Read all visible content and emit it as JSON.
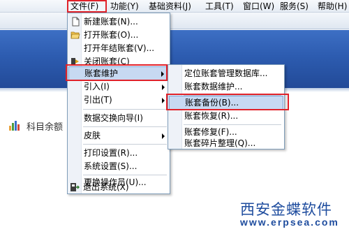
{
  "menubar": {
    "items": [
      {
        "label": "文件(F)",
        "key": "file"
      },
      {
        "label": "功能(Y)",
        "key": "func"
      },
      {
        "label": "基础资料(J)",
        "key": "base"
      },
      {
        "label": "工具(T)",
        "key": "tools"
      },
      {
        "label": "窗口(W)",
        "key": "window"
      },
      {
        "label": "服务(S)",
        "key": "service"
      },
      {
        "label": "帮助(H)",
        "key": "help"
      }
    ]
  },
  "file_menu": {
    "items": [
      {
        "label": "新建账套(N)...",
        "icon": "new-file-icon"
      },
      {
        "label": "打开账套(O)...",
        "icon": "open-folder-icon"
      },
      {
        "label": "打开年结账套(V)...",
        "icon": ""
      },
      {
        "label": "关闭账套(C)",
        "icon": "close-ledger-icon"
      },
      {
        "label": "账套维护",
        "icon": "",
        "submenu": true
      },
      {
        "label": "引入(I)",
        "icon": "",
        "submenu": true
      },
      {
        "label": "引出(T)",
        "icon": "",
        "submenu": true
      },
      {
        "label": "数据交换向导(I)",
        "icon": ""
      },
      {
        "label": "皮肤",
        "icon": "",
        "submenu": true
      },
      {
        "label": "打印设置(R)...",
        "icon": ""
      },
      {
        "label": "系统设置(S)...",
        "icon": ""
      },
      {
        "label": "更换操作员(U)...",
        "icon": ""
      },
      {
        "label": "退出系统(X)",
        "icon": "exit-icon"
      }
    ]
  },
  "ledger_submenu": {
    "items": [
      {
        "label": "定位账套管理数据库..."
      },
      {
        "label": "账套数据维护..."
      },
      {
        "label": "账套备份(B)..."
      },
      {
        "label": "账套恢复(R)..."
      },
      {
        "label": "账套修复(F)..."
      },
      {
        "label": "账套碎片整理(Q)..."
      }
    ]
  },
  "desktop": {
    "item_label": "科目余额"
  },
  "brand": {
    "name": "西安金蝶软件",
    "url": "www.erpsea.com"
  },
  "colors": {
    "highlight_red": "#e0222a",
    "band_blue": "#2d5cb0",
    "brand_blue": "#1e4c9e"
  }
}
